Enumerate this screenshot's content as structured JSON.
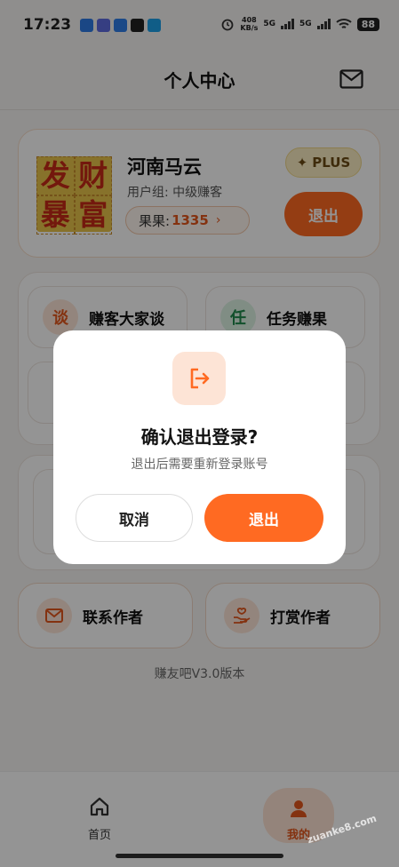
{
  "status_bar": {
    "time": "17:23",
    "net_speed_value": "408",
    "net_speed_unit": "KB/s",
    "sim1": "5G",
    "sim2": "5G",
    "battery": "88"
  },
  "header": {
    "title": "个人中心"
  },
  "profile": {
    "avatar_chars": [
      "发",
      "财",
      "暴",
      "富"
    ],
    "name": "河南马云",
    "group": "用户组: 中级赚客",
    "coins_label": "果果:",
    "coins_value": "1335",
    "plus_label": "PLUS",
    "logout_label": "退出"
  },
  "menu": [
    {
      "icon_char": "谈",
      "label": "赚客大家谈",
      "icon_color": "#e4571c",
      "icon_bg": "#fde6d8"
    },
    {
      "icon_char": "任",
      "label": "任务赚果",
      "icon_color": "#1f8a4c",
      "icon_bg": "#ddf3e4"
    }
  ],
  "bottom_items": [
    {
      "label": "联系作者",
      "icon": "mail-icon"
    },
    {
      "label": "打赏作者",
      "icon": "gift-hand-icon"
    }
  ],
  "version": "赚友吧V3.0版本",
  "nav": {
    "home_label": "首页",
    "me_label": "我的"
  },
  "dialog": {
    "title": "确认退出登录?",
    "subtitle": "退出后需要重新登录账号",
    "cancel_label": "取消",
    "confirm_label": "退出"
  },
  "watermark": "zuanke8.com",
  "colors": {
    "accent": "#ff6a22",
    "accent_text": "#e4571c"
  }
}
